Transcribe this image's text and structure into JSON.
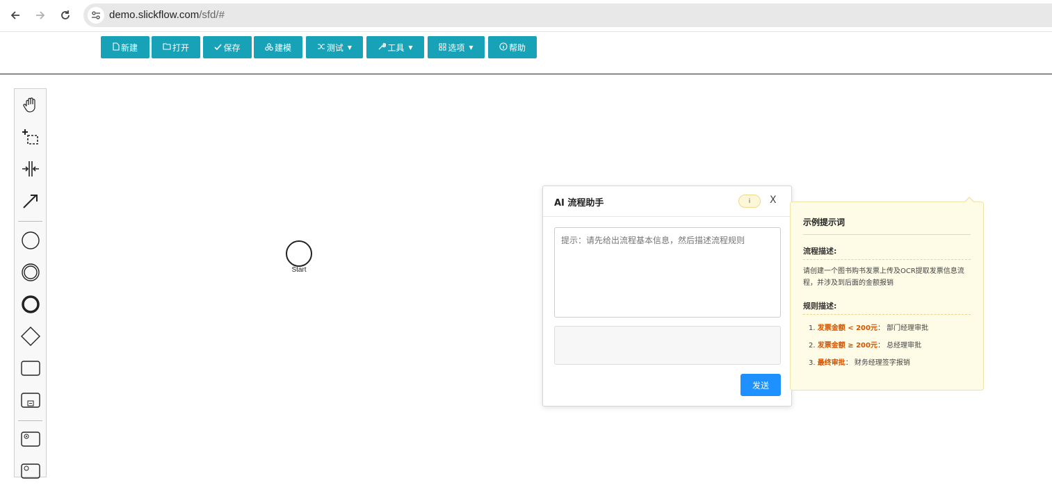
{
  "browser": {
    "url_host": "demo.slickflow.com",
    "url_path": "/sfd/#"
  },
  "toolbar": {
    "buttons": [
      {
        "label": "新建",
        "icon": "file-icon"
      },
      {
        "label": "打开",
        "icon": "folder-icon"
      },
      {
        "label": "保存",
        "icon": "check-icon"
      },
      {
        "label": "建模",
        "icon": "model-icon"
      },
      {
        "label": "测试",
        "icon": "shuffle-icon",
        "dropdown": true
      },
      {
        "label": "工具",
        "icon": "wrench-icon",
        "dropdown": true
      },
      {
        "label": "选项",
        "icon": "grid-icon",
        "dropdown": true
      },
      {
        "label": "帮助",
        "icon": "info-icon"
      }
    ]
  },
  "palette": {
    "tools": [
      "hand-tool-icon",
      "lasso-tool-icon",
      "space-tool-icon",
      "connect-tool-icon",
      "start-event-icon",
      "intermediate-event-icon",
      "end-event-icon",
      "gateway-icon",
      "task-icon",
      "subprocess-icon",
      "service-task-icon",
      "service-task-2-icon"
    ]
  },
  "canvas": {
    "start_label": "Start"
  },
  "ai_dialog": {
    "title": "AI 流程助手",
    "info_label": "i",
    "close_label": "X",
    "prompt_placeholder": "提示：请先给出流程基本信息，然后描述流程规则",
    "send_label": "发送"
  },
  "tips": {
    "title": "示例提示词",
    "flow_heading": "流程描述:",
    "flow_text": "请创建一个图书购书发票上传及OCR提取发票信息流程，并涉及到后面的金额报销",
    "rules_heading": "规则描述:",
    "rules": [
      {
        "num": "1.",
        "key": "发票金额 < 200元",
        "sep": "：",
        "value": "部门经理审批"
      },
      {
        "num": "2.",
        "key": "发票金额 ≥ 200元",
        "sep": "：",
        "value": "总经理审批"
      },
      {
        "num": "3.",
        "key": "最终审批",
        "sep": "：",
        "value": "财务经理签字报销"
      }
    ]
  },
  "colors": {
    "toolbar_button": "#17a2b8",
    "send_button": "#1e90ff",
    "tips_background": "#fefbe6",
    "rule_highlight": "#d35400"
  }
}
